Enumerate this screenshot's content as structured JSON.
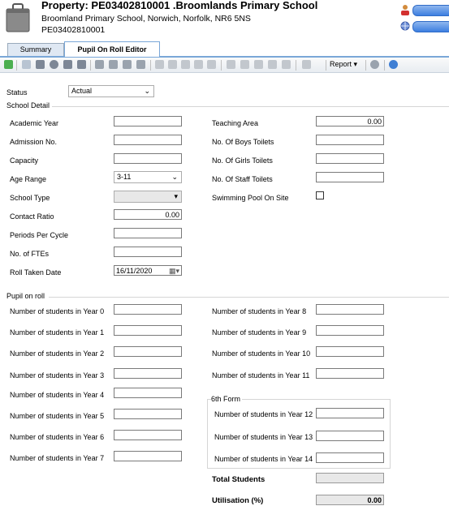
{
  "header": {
    "title": "Property: PE03402810001 .Broomlands Primary School",
    "address": "Broomland Primary School, Norwich, Norfolk, NR6 5NS",
    "code": "PE03402810001",
    "icons": [
      "briefcase-icon",
      "user-icon",
      "globe-icon"
    ]
  },
  "tabs": [
    {
      "label": "Summary"
    },
    {
      "label": "Pupil On Roll Editor"
    }
  ],
  "toolbar": {
    "report_label": "Report"
  },
  "status": {
    "label": "Status",
    "value": "Actual"
  },
  "school_detail": {
    "section_label": "School Detail",
    "academic_year": "Academic Year",
    "admission_no": "Admission No.",
    "capacity": "Capacity",
    "age_range": {
      "label": "Age Range",
      "value": "3-11"
    },
    "school_type": "School Type",
    "contact_ratio": {
      "label": "Contact Ratio",
      "value": "0.00"
    },
    "periods_per_cycle": "Periods Per Cycle",
    "no_of_ftes": "No. of FTEs",
    "roll_taken_date": {
      "label": "Roll Taken Date",
      "value": "16/11/2020"
    },
    "teaching_area": {
      "label": "Teaching Area",
      "value": "0.00"
    },
    "boys_toilets": "No. Of Boys Toilets",
    "girls_toilets": "No. Of Girls Toilets",
    "staff_toilets": "No. Of Staff Toilets",
    "swimming_pool": "Swimming Pool On Site"
  },
  "pupil_on_roll": {
    "section_label": "Pupil on roll",
    "left": [
      "Number of students in Year 0",
      "Number of students in Year 1",
      "Number of students in Year 2",
      "Number of students in Year 3",
      "Number of students in Year 4",
      "Number of students in Year 5",
      "Number of students in Year 6",
      "Number of students in Year 7"
    ],
    "right": [
      "Number of students in Year 8",
      "Number of students in Year 9",
      "Number of students in Year 10",
      "Number of students in Year 11"
    ],
    "sixth_form": {
      "label": "6th Form",
      "rows": [
        "Number of students in Year 12",
        "Number of students in Year 13",
        "Number of students in Year 14"
      ]
    },
    "total_students": "Total Students",
    "utilisation": {
      "label": "Utilisation (%)",
      "value": "0.00"
    }
  }
}
